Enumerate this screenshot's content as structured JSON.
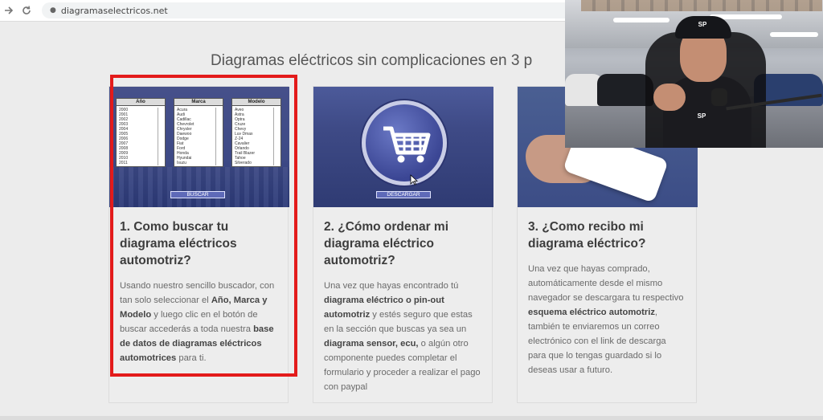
{
  "browser": {
    "url": "diagramaselectricos.net",
    "back_icon": "arrow-right-icon",
    "reload_icon": "reload-icon"
  },
  "page": {
    "heading": "Diagramas eléctricos sin complicaciones en 3 p"
  },
  "cards": [
    {
      "title": "1. Como buscar tu diagrama eléctricos automotriz?",
      "image": {
        "boxes": [
          {
            "label": "Año",
            "items": [
              "2000",
              "2001",
              "2002",
              "2003",
              "2004",
              "2005",
              "2006",
              "2007",
              "2008",
              "2009",
              "2010",
              "2011"
            ]
          },
          {
            "label": "Marca",
            "items": [
              "Acura",
              "Audi",
              "Cadillac",
              "Chevrolet",
              "Chrysler",
              "Daewoo",
              "Dodge",
              "Fiat",
              "Ford",
              "Honda",
              "Hyundai",
              "Isuzu"
            ]
          },
          {
            "label": "Modelo",
            "items": [
              "Aveo",
              "Astra",
              "Optra",
              "Cruze",
              "Chevy",
              "Luv Dmax",
              "Z-24",
              "Cavalier",
              "Orlando",
              "Trail Blazer",
              "Tahoe",
              "Silverado"
            ]
          }
        ],
        "button": "BUSCAR"
      },
      "text_parts": [
        {
          "t": "Usando nuestro sencillo buscador, con tan solo seleccionar el ",
          "b": false
        },
        {
          "t": "Año, Marca y Modelo",
          "b": true
        },
        {
          "t": " y luego clic en el botón de buscar accederás a toda nuestra ",
          "b": false
        },
        {
          "t": "base de datos de diagramas eléctricos automotrices",
          "b": true
        },
        {
          "t": " para ti.",
          "b": false
        }
      ]
    },
    {
      "title": "2. ¿Cómo ordenar mi diagrama eléctrico automotriz?",
      "image": {
        "button": "DESCARGAR"
      },
      "text_parts": [
        {
          "t": "Una vez que hayas encontrado tú ",
          "b": false
        },
        {
          "t": "diagrama eléctrico o pin-out automotriz",
          "b": true
        },
        {
          "t": " y estés seguro que estas en la sección que buscas ya sea un ",
          "b": false
        },
        {
          "t": "diagrama sensor, ecu,",
          "b": true
        },
        {
          "t": " o algún otro componente puedes completar el formulario y proceder a realizar el pago con paypal",
          "b": false
        }
      ]
    },
    {
      "title": "3. ¿Como recibo mi diagrama eléctrico?",
      "image": {},
      "text_parts": [
        {
          "t": "Una vez que hayas comprado, automáticamente desde el mismo navegador se descargara tu respectivo ",
          "b": false
        },
        {
          "t": "esquema eléctrico automotriz",
          "b": true
        },
        {
          "t": ", también te enviaremos un correo electrónico con el link de descarga para que lo tengas guardado si lo deseas usar a futuro.",
          "b": false
        }
      ]
    }
  ],
  "webcam": {
    "cap_logo": "SP",
    "shirt_logo": "SP"
  },
  "colors": {
    "annotation": "#e31b1b",
    "card_image_blue": "#3e4a86"
  }
}
